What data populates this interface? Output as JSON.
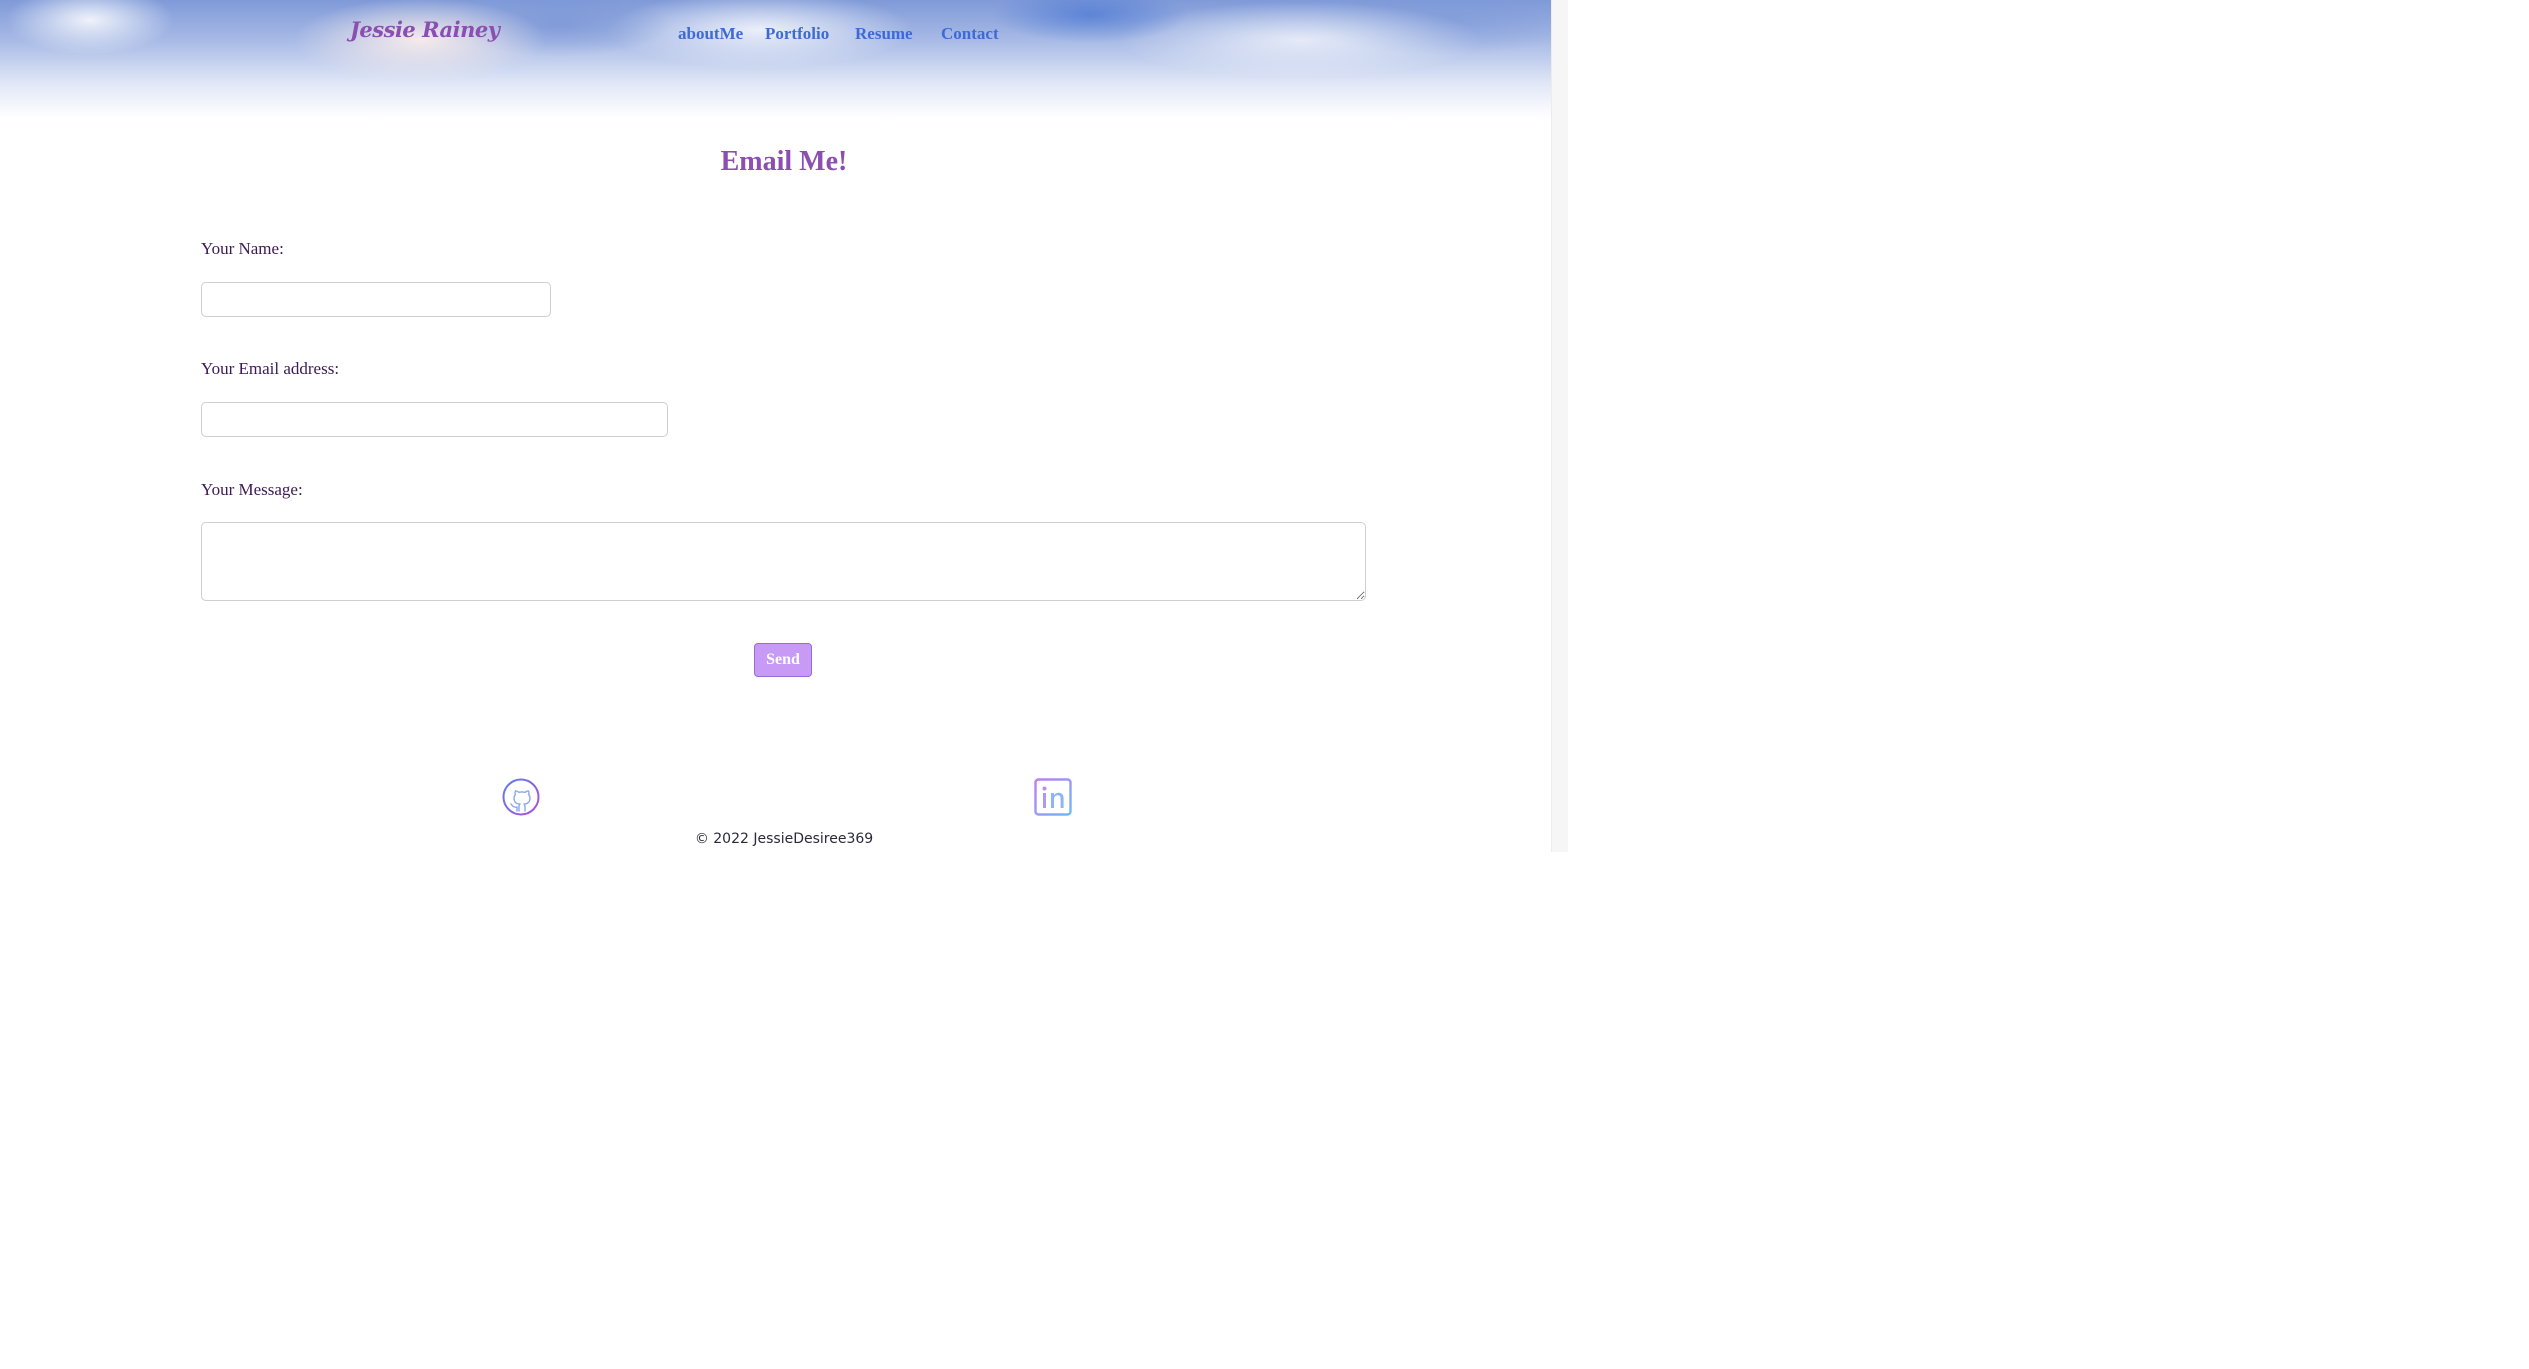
{
  "header": {
    "brand": "Jessie Rainey",
    "nav": [
      {
        "label": "aboutMe"
      },
      {
        "label": "Portfolio"
      },
      {
        "label": "Resume"
      },
      {
        "label": "Contact"
      }
    ]
  },
  "main": {
    "heading": "Email Me!",
    "form": {
      "name_label": "Your Name:",
      "name_value": "",
      "email_label": "Your Email address:",
      "email_value": "",
      "message_label": "Your Message:",
      "message_value": "",
      "send_label": "Send"
    }
  },
  "footer": {
    "icons": [
      "github-icon",
      "linkedin-icon"
    ],
    "copyright": "© 2022 JessieDesiree369"
  },
  "colors": {
    "brand": "#8a4fb0",
    "nav_link": "#3e6ad6",
    "label_text": "#3c1a55",
    "send_button": "#c79bf5"
  }
}
